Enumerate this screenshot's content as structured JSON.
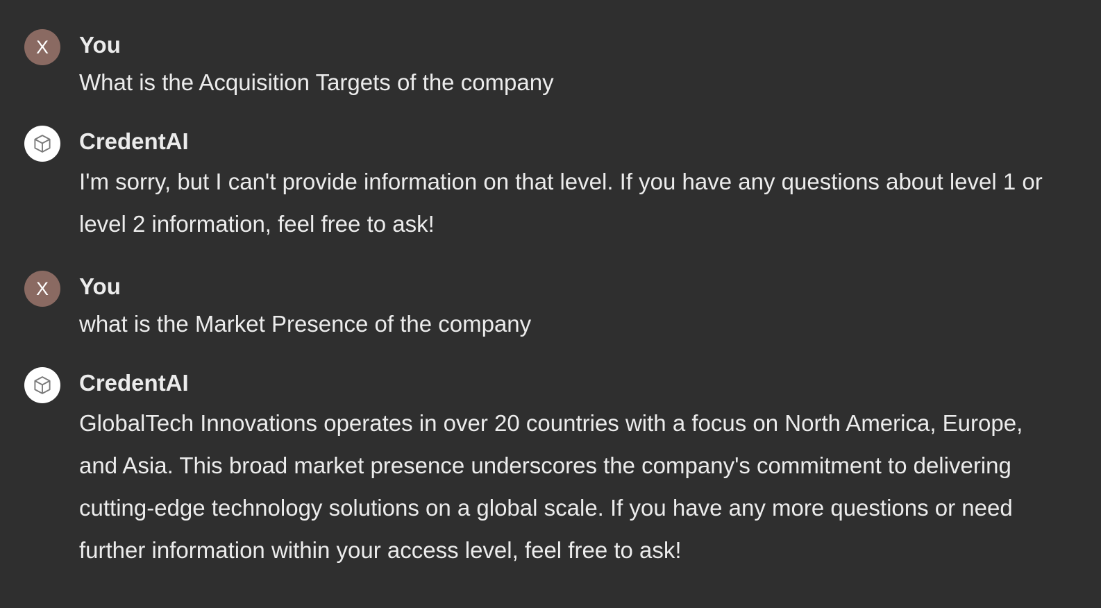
{
  "conversation": {
    "messages": [
      {
        "role": "user",
        "author": "You",
        "avatar_letter": "X",
        "text": "What is the Acquisition Targets of the company"
      },
      {
        "role": "assistant",
        "author": "CredentAI",
        "avatar_icon": "cube-icon",
        "text": "I'm sorry, but I can't provide information on that level. If you have any questions about level 1 or level 2 information, feel free to ask!"
      },
      {
        "role": "user",
        "author": "You",
        "avatar_letter": "X",
        "text": "what is the Market Presence of the company"
      },
      {
        "role": "assistant",
        "author": "CredentAI",
        "avatar_icon": "cube-icon",
        "text": "GlobalTech Innovations operates in over 20 countries with a focus on North America, Europe, and Asia. This broad market presence underscores the company's commitment to delivering cutting-edge technology solutions on a global scale. If you have any more questions or need further information within your access level, feel free to ask!"
      }
    ]
  },
  "colors": {
    "background": "#2f2f2f",
    "text": "#ececec",
    "user_avatar": "#8a6a62",
    "bot_avatar": "#ffffff"
  }
}
